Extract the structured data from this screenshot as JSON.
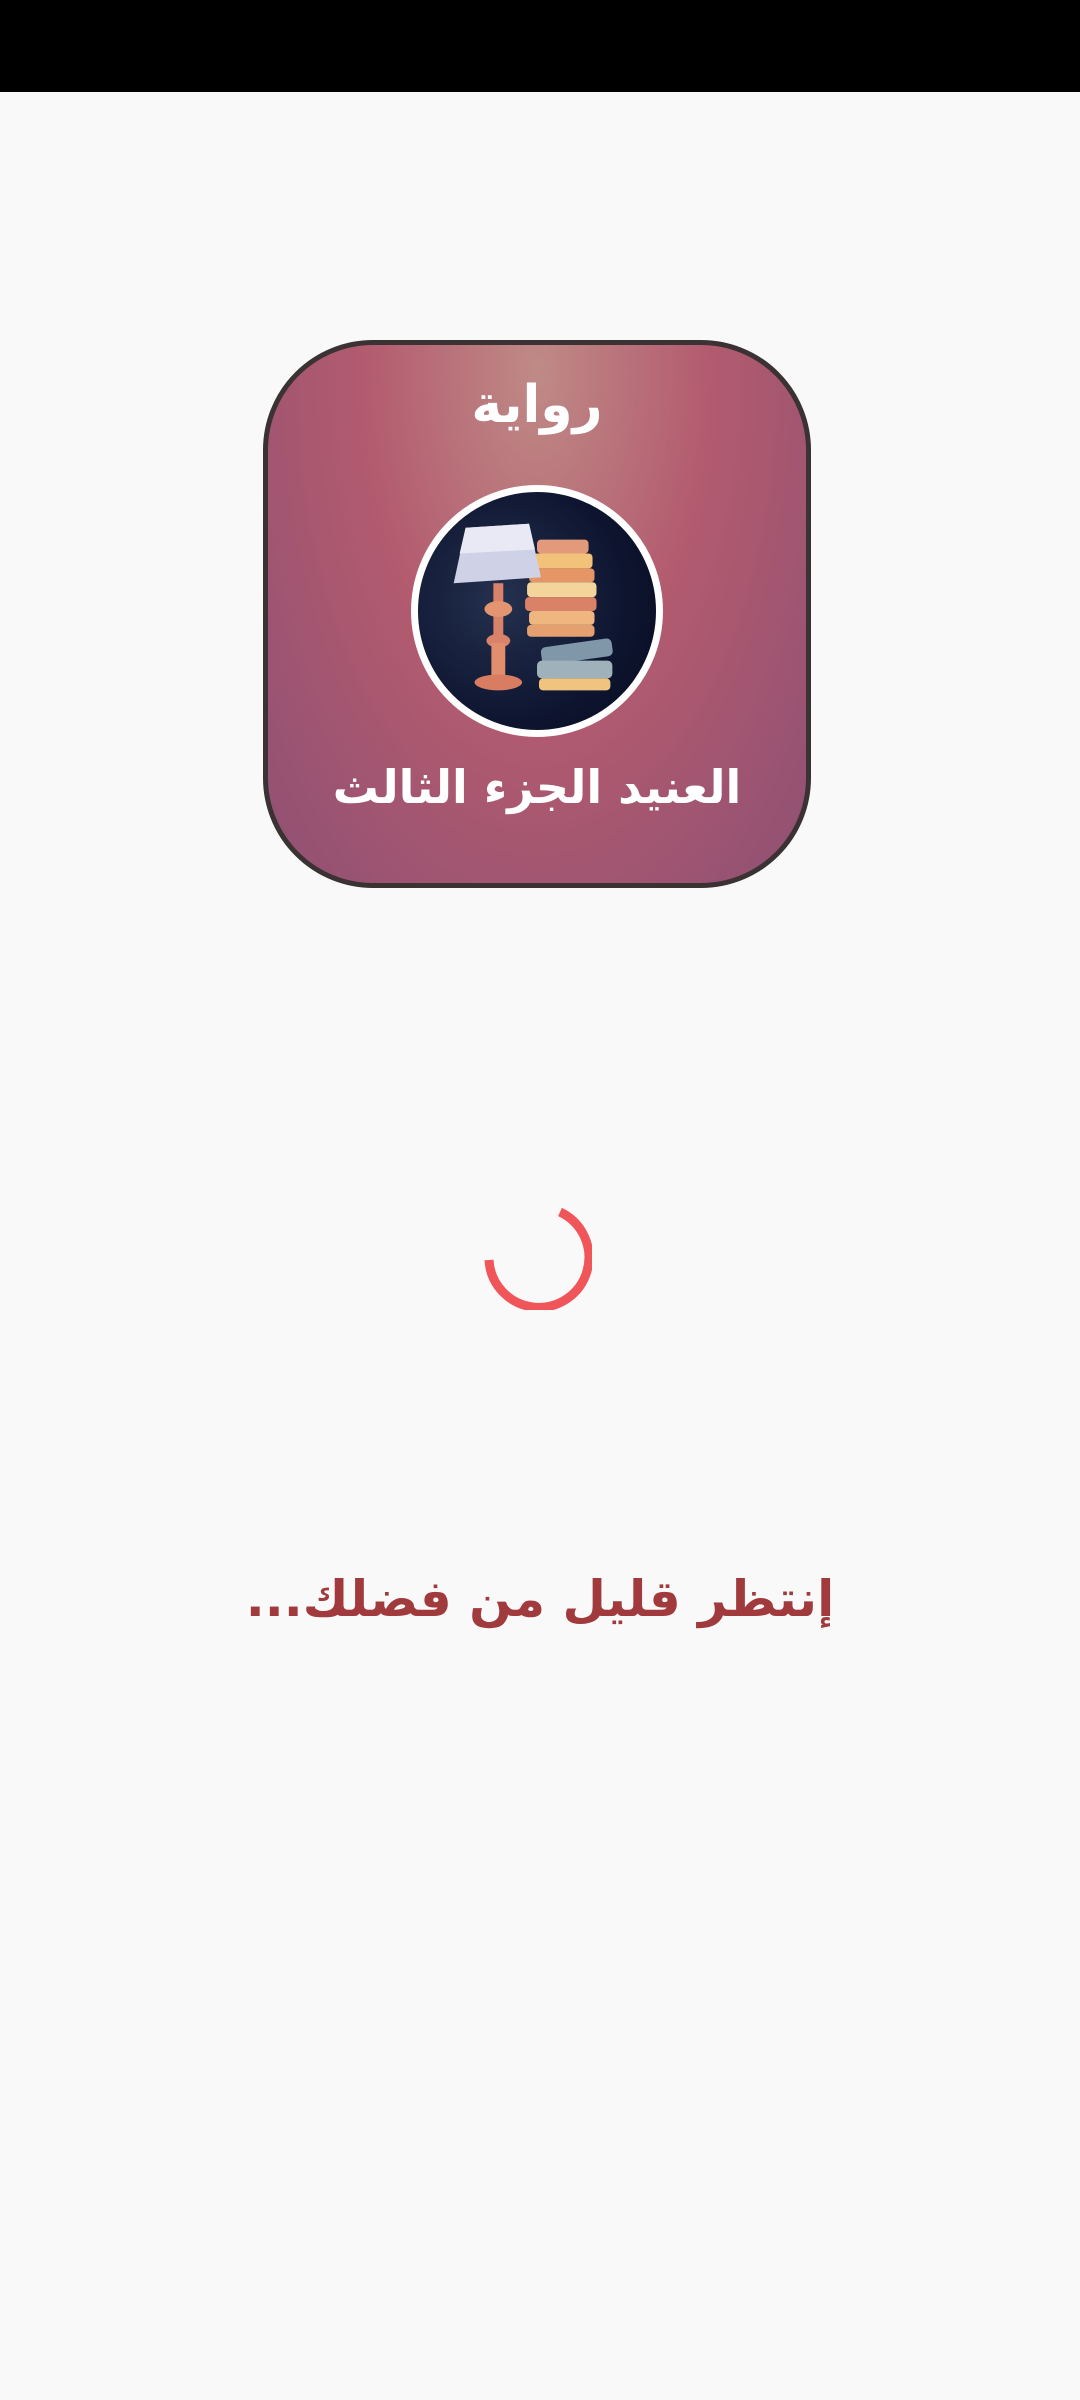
{
  "app_icon": {
    "top_label": "رواية",
    "bottom_label": "العنيد الجزء الثالث",
    "illustration": "lamp-and-books-illustration"
  },
  "spinner": {
    "icon": "loading-spinner-icon",
    "color": "#f0555a"
  },
  "loading": {
    "message": "إنتظر قليل من فضلك..."
  },
  "colors": {
    "status_bar": "#000000",
    "background": "#f9f9f9",
    "loading_text": "#a13a3c"
  }
}
